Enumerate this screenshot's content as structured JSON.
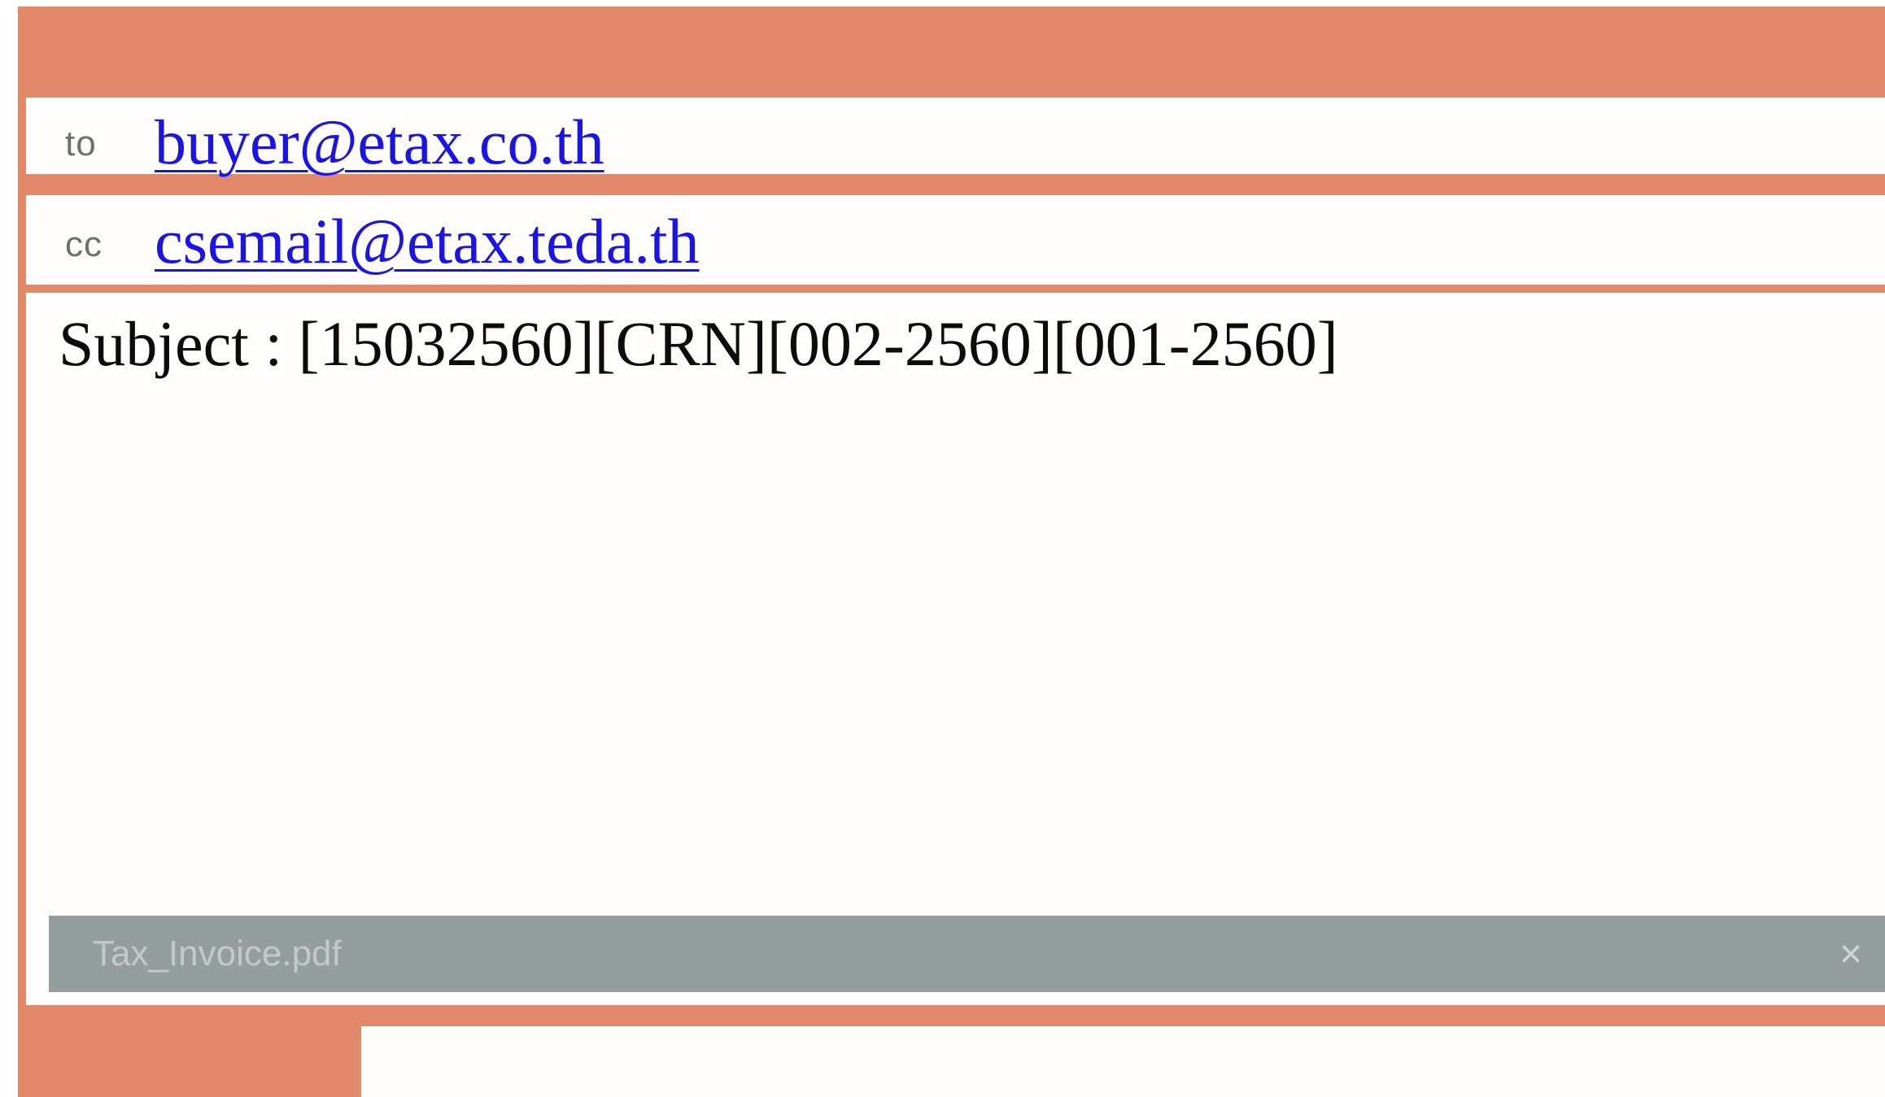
{
  "email": {
    "to_label": "to",
    "to_address": "buyer@etax.co.th",
    "cc_label": "cc",
    "cc_address": "csemail@etax.teda.th",
    "subject": "Subject : [15032560][CRN][002-2560][001-2560]",
    "attachment": {
      "filename": "Tax_Invoice.pdf",
      "close_symbol": "×"
    }
  },
  "colors": {
    "accent": "#e1896a",
    "link": "#1a14e6",
    "attachment_bar": "#959e9e"
  }
}
